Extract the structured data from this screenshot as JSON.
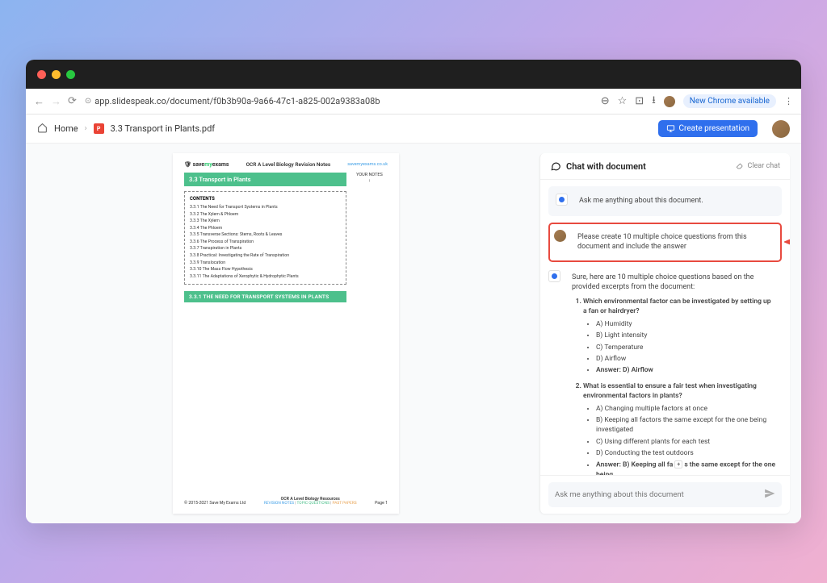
{
  "browser": {
    "url": "app.slidespeak.co/document/f0b3b90a-9a66-47c1-a825-002a9383a08b",
    "chrome_button": "New Chrome available"
  },
  "app_header": {
    "home": "Home",
    "doc_name": "3.3 Transport in Plants.pdf",
    "create_btn": "Create presentation"
  },
  "doc": {
    "logo_prefix": "save",
    "logo_accent": "my",
    "logo_suffix": "exams",
    "brand_mid": "OCR A Level Biology Revision Notes",
    "brand_link": "savemyexams.co.uk",
    "your_notes": "YOUR NOTES",
    "arrow": "↓",
    "section_title": "3.3 Transport in Plants",
    "contents_label": "CONTENTS",
    "contents": [
      "3.3.1 The Need for Transport Systems in Plants",
      "3.3.2 The Xylem & Phloem",
      "3.3.3 The Xylem",
      "3.3.4 The Phloem",
      "3.3.5 Transverse Sections: Stems, Roots & Leaves",
      "3.3.6 The Process of Transpiration",
      "3.3.7 Transpiration in Plants",
      "3.3.8 Practical: Investigating the Rate of Transpiration",
      "3.3.9 Translocation",
      "3.3.10 The Mass Flow Hypothesis",
      "3.3.11 The Adaptations of Xerophytic & Hydrophytic Plants"
    ],
    "subsection": "3.3.1 THE NEED FOR TRANSPORT SYSTEMS IN PLANTS",
    "footer_left": "© 2015-2021 Save My Exams Ltd",
    "footer_mid": "OCR A Level Biology Resources",
    "footer_rev": "REVISION NOTES",
    "footer_topic": "TOPIC QUESTIONS",
    "footer_past": "PAST PAPERS",
    "footer_page": "Page 1"
  },
  "chat": {
    "title": "Chat with document",
    "clear": "Clear chat",
    "intro": "Ask me anything about this document.",
    "user_message": "Please create 10 multiple choice questions from this document and include the answer",
    "response_intro": "Sure, here are 10 multiple choice questions based on the provided excerpts from the document:",
    "q1": "Which environmental factor can be investigated by setting up a fan or hairdryer?",
    "q1a": "A) Humidity",
    "q1b": "B) Light intensity",
    "q1c": "C) Temperature",
    "q1d": "D) Airflow",
    "q1ans": "Answer: D) Airflow",
    "q2": "What is essential to ensure a fair test when investigating environmental factors in plants?",
    "q2a": "A) Changing multiple factors at once",
    "q2b": "B) Keeping all factors the same except for the one being investigated",
    "q2c": "C) Using different plants for each test",
    "q2d": "D) Conducting the test outdoors",
    "q2ans_pre": "Answer: B) Keeping all fa",
    "q2ans_post": "s the same except for the one being",
    "input_placeholder": "Ask me anything about this document"
  }
}
